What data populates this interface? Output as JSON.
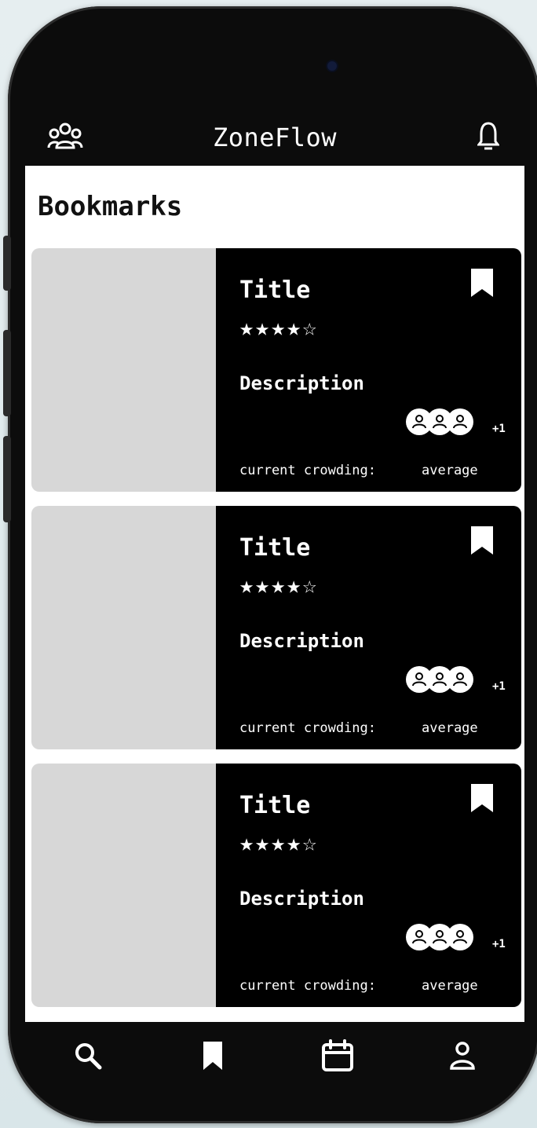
{
  "app": {
    "title": "ZoneFlow"
  },
  "page": {
    "title": "Bookmarks"
  },
  "cards": [
    {
      "title": "Title",
      "rating": "★★★★☆",
      "description": "Description",
      "extra_count": "+1",
      "crowding_label": "current crowding:",
      "crowding_value": "average"
    },
    {
      "title": "Title",
      "rating": "★★★★☆",
      "description": "Description",
      "extra_count": "+1",
      "crowding_label": "current crowding:",
      "crowding_value": "average"
    },
    {
      "title": "Title",
      "rating": "★★★★☆",
      "description": "Description",
      "extra_count": "+1",
      "crowding_label": "current crowding:",
      "crowding_value": "average"
    }
  ],
  "nav": {
    "items": [
      {
        "icon": "search-icon"
      },
      {
        "icon": "bookmark-icon"
      },
      {
        "icon": "calendar-icon"
      },
      {
        "icon": "user-icon"
      }
    ]
  },
  "colors": {
    "panel": "#000000",
    "image_placeholder": "#d7d7d7",
    "screen": "#ffffff"
  }
}
